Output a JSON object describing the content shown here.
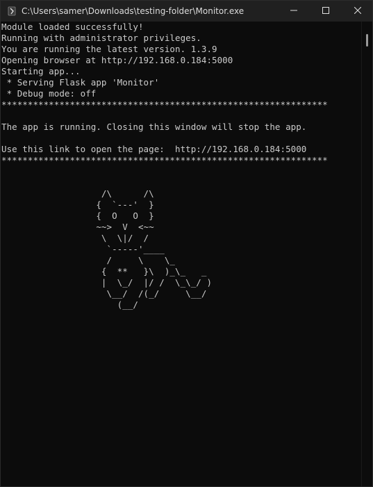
{
  "window": {
    "title": "C:\\Users\\samer\\Downloads\\testing-folder\\Monitor.exe"
  },
  "console": {
    "lines": [
      "Module loaded successfully!",
      "Running with administrator privileges.",
      "You are running the latest version. 1.3.9",
      "Opening browser at http://192.168.0.184:5000",
      "Starting app...",
      " * Serving Flask app 'Monitor'",
      " * Debug mode: off",
      "**************************************************************",
      "",
      "The app is running. Closing this window will stop the app.",
      "",
      "Use this link to open the page:  http://192.168.0.184:5000",
      "**************************************************************",
      "",
      "",
      "                   /\\      /\\",
      "                  {  `---'  }",
      "                  {  O   O  }",
      "                  ~~>  V  <~~",
      "                   \\  \\|/  /",
      "                    `-----'____",
      "                    /     \\    \\_",
      "                   {  **   }\\  )_\\_   _",
      "                   |  \\_/  |/ /  \\_\\_/ )",
      "                    \\__/  /(_/     \\__/",
      "                      (__/"
    ]
  },
  "colors": {
    "background": "#0c0c0c",
    "foreground": "#cccccc",
    "titlebar": "#202020"
  },
  "icons": {
    "app": "console-app-icon",
    "minimize": "minimize-icon",
    "maximize": "maximize-icon",
    "close": "close-icon"
  }
}
